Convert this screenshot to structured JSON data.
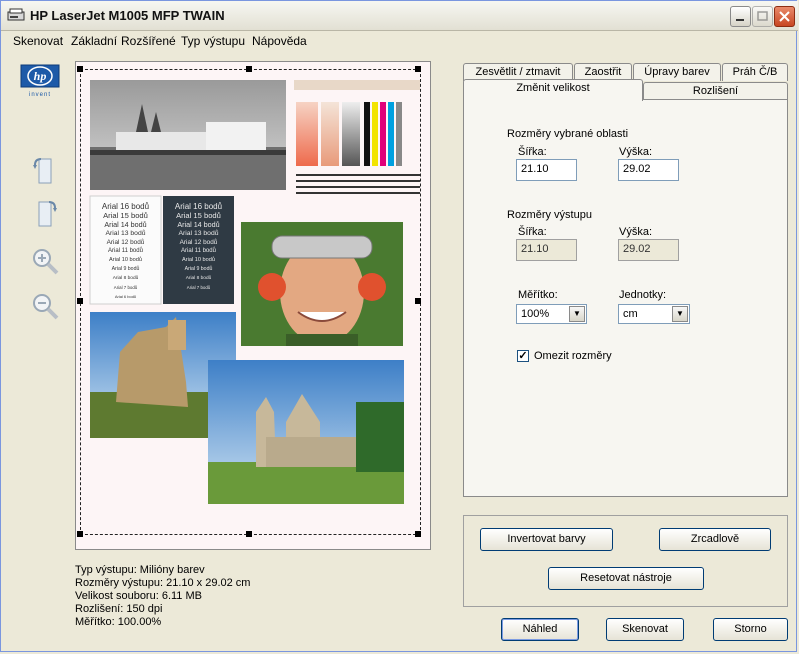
{
  "window": {
    "title": "HP LaserJet M1005 MFP TWAIN"
  },
  "menu": [
    {
      "label": "Skenovat"
    },
    {
      "label": "Základní"
    },
    {
      "label": "Rozšířené"
    },
    {
      "label": "Typ výstupu"
    },
    {
      "label": "Nápověda"
    }
  ],
  "logo": {
    "brand": "hp",
    "tagline": "invent"
  },
  "tools": [
    "rotate-left-icon",
    "rotate-right-icon",
    "zoom-in-icon",
    "zoom-out-icon"
  ],
  "preview": {
    "samples_light": [
      "Arial 16 bodů",
      "Arial 15 bodů",
      "Arial 14 bodů",
      "Arial 13 bodů",
      "Arial 12 bodů",
      "Arial 11 bodů",
      "Arial 10 bodů",
      "Arial 9 bodů",
      "Arial 8 bodů",
      "Arial 7 bodů",
      "Arial 6 bodů"
    ],
    "samples_dark": [
      "Arial 16 bodů",
      "Arial 15 bodů",
      "Arial 14 bodů",
      "Arial 13 bodů",
      "Arial 12 bodů",
      "Arial 11 bodů",
      "Arial 10 bodů",
      "Arial 9 bodů",
      "Arial 8 bodů",
      "Arial 7 bodů"
    ]
  },
  "info": {
    "output_type": "Typ výstupu:  Milióny barev",
    "output_size": "Rozměry výstupu:  21.10 x 29.02 cm",
    "file_size": "Velikost souboru:  6.11 MB",
    "resolution": "Rozlišení:  150 dpi",
    "scale": "Měřítko:  100.00%"
  },
  "tabs_row1": [
    {
      "label": "Zesvětlit / ztmavit"
    },
    {
      "label": "Zaostřit"
    },
    {
      "label": "Úpravy barev"
    },
    {
      "label": "Práh Č/B"
    }
  ],
  "tabs_row2": [
    {
      "label": "Změnit velikost"
    },
    {
      "label": "Rozlišení"
    }
  ],
  "resize": {
    "selected_heading": "Rozměry vybrané oblasti",
    "width_label": "Šířka:",
    "height_label": "Výška:",
    "selected_width": "21.10",
    "selected_height": "29.02",
    "output_heading": "Rozměry výstupu",
    "output_width": "21.10",
    "output_height": "29.02",
    "scale_label": "Měřítko:",
    "scale_value": "100%",
    "units_label": "Jednotky:",
    "units_value": "cm",
    "constrain_label": "Omezit rozměry",
    "constrain_checked": true
  },
  "tools_group": {
    "invert": "Invertovat barvy",
    "mirror": "Zrcadlově",
    "reset": "Resetovat nástroje"
  },
  "actions": {
    "preview": "Náhled",
    "scan": "Skenovat",
    "cancel": "Storno"
  }
}
